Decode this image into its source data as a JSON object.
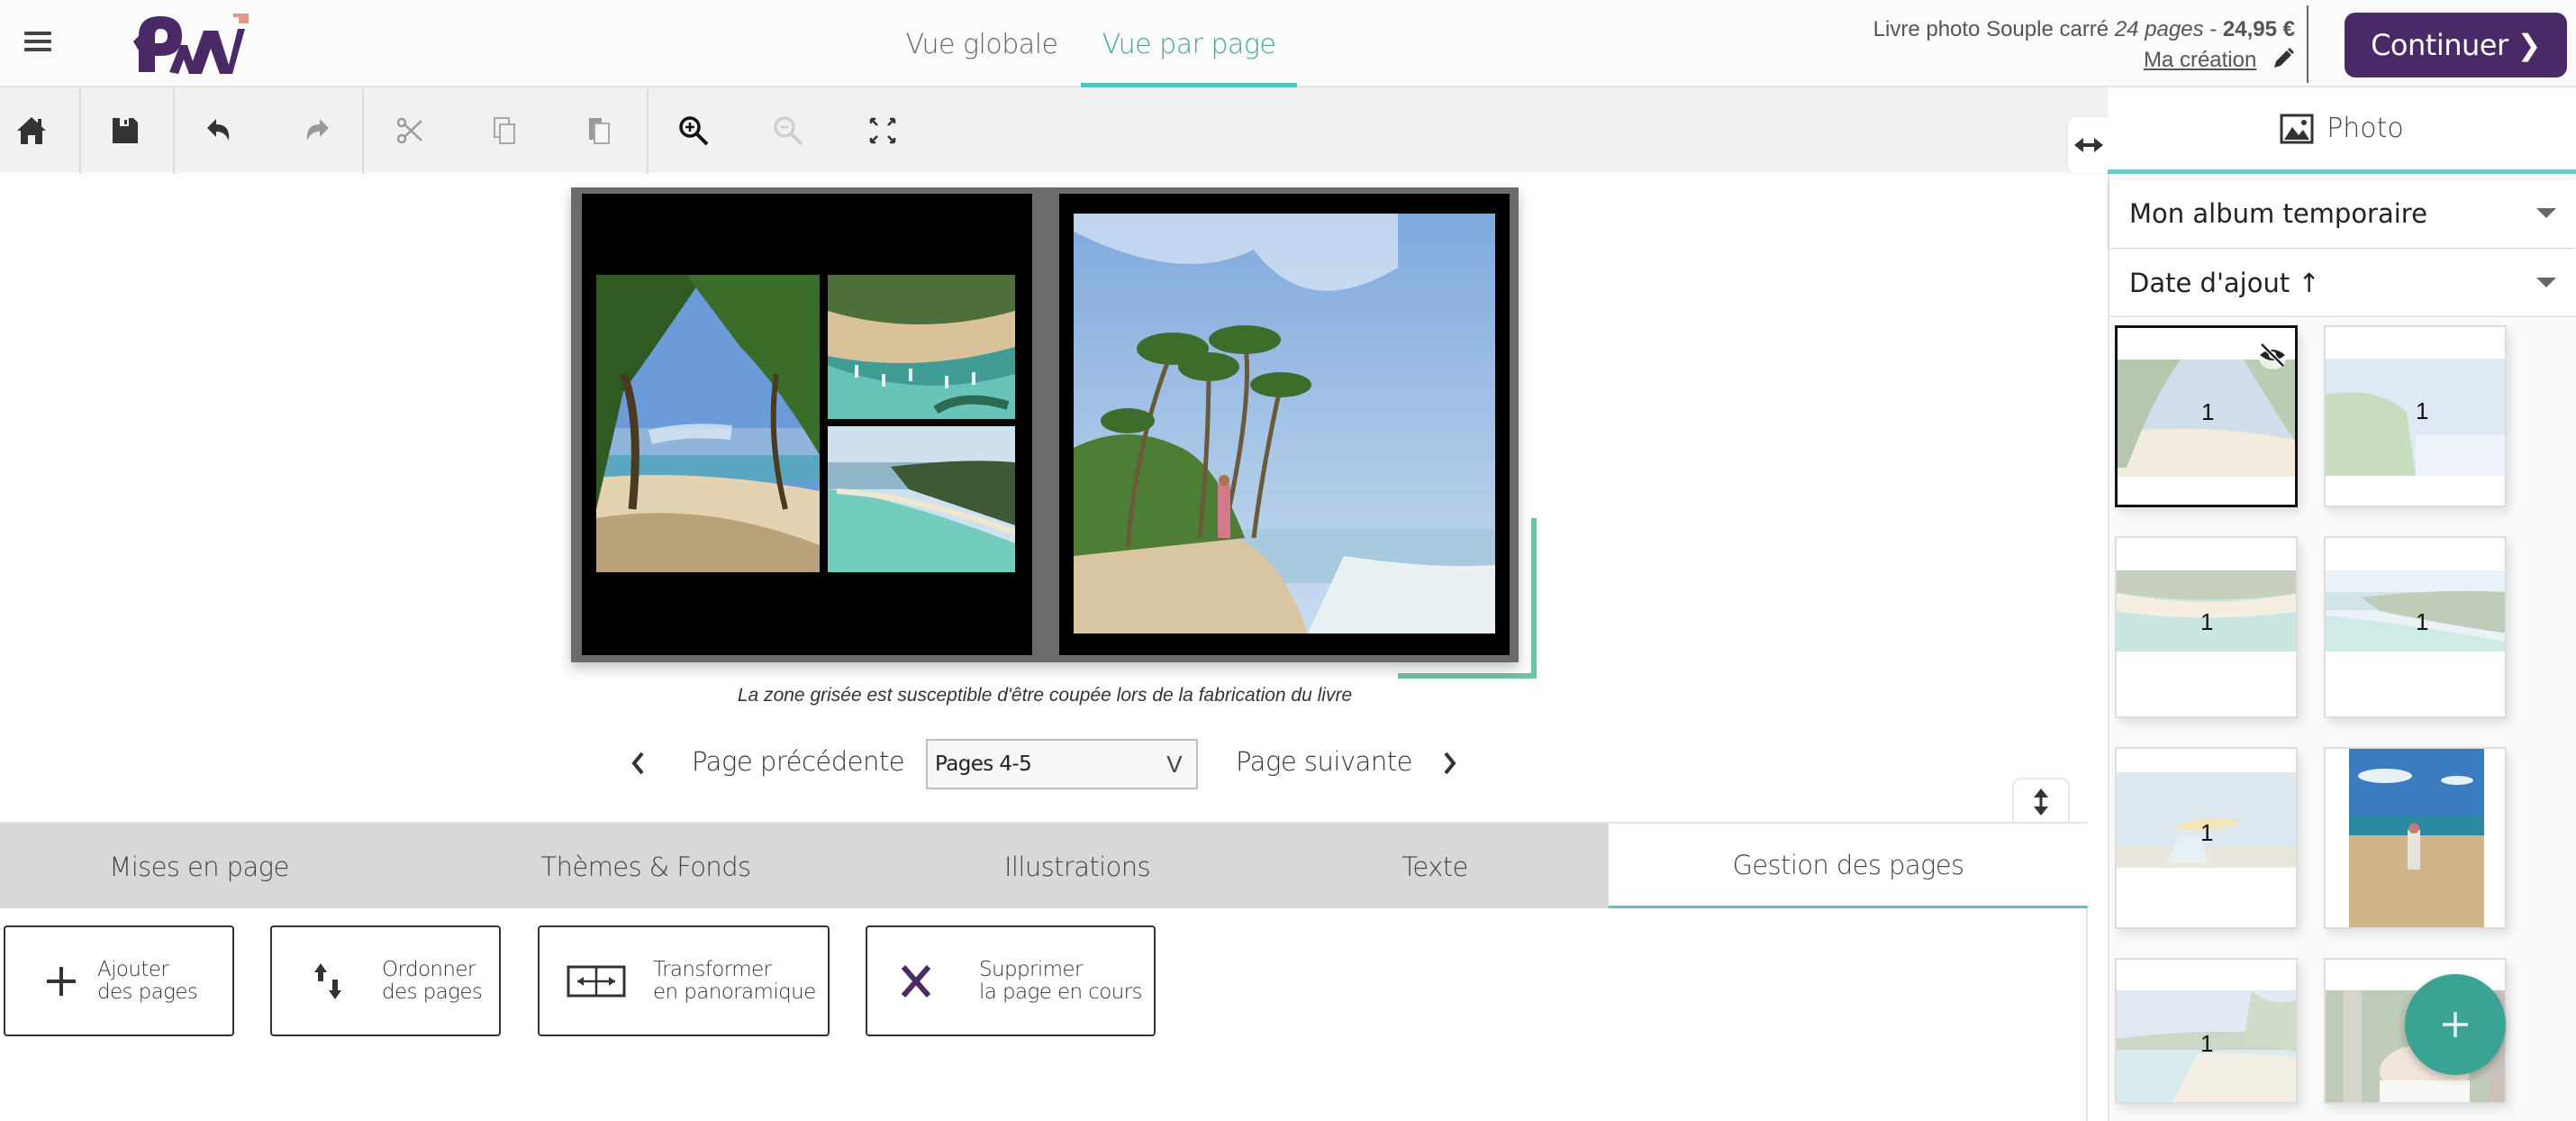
{
  "header": {
    "logo_text": "PW",
    "view_tabs": [
      {
        "label": "Vue globale",
        "active": false
      },
      {
        "label": "Vue par page",
        "active": true
      }
    ],
    "product": {
      "name": "Livre photo Souple carré",
      "pages": "24 pages",
      "separator": " - ",
      "price": "24,95 €"
    },
    "creation_link": "Ma création",
    "continue_label": "Continuer",
    "continue_chevron": "❯"
  },
  "toolbar": {
    "items": [
      {
        "name": "home",
        "enabled": true
      },
      {
        "name": "save",
        "enabled": true
      },
      {
        "name": "undo",
        "enabled": true
      },
      {
        "name": "redo",
        "enabled": false
      },
      {
        "name": "cut",
        "enabled": false
      },
      {
        "name": "copy",
        "enabled": false
      },
      {
        "name": "paste",
        "enabled": false
      },
      {
        "name": "zoom-in",
        "enabled": true
      },
      {
        "name": "zoom-out",
        "enabled": false
      },
      {
        "name": "fit-screen",
        "enabled": true
      }
    ]
  },
  "canvas": {
    "caption": "La zone grisée est susceptible d'être coupée lors de la fabrication du livre",
    "colors": {
      "page_bg": "#000000",
      "bleed": "#6b6b6b",
      "crop_guide": "#6cc3a8"
    }
  },
  "page_nav": {
    "prev_label": "Page précédente",
    "next_label": "Page suivante",
    "selected_pages": "Pages 4-5",
    "select_caret": "V"
  },
  "bottom_tabs": [
    {
      "label": "Mises en page",
      "active": false
    },
    {
      "label": "Thèmes & Fonds",
      "active": false
    },
    {
      "label": "Illustrations",
      "active": false
    },
    {
      "label": "Texte",
      "active": false
    },
    {
      "label": "Gestion des pages",
      "active": true
    }
  ],
  "page_actions": [
    {
      "line1": "Ajouter",
      "line2": "des pages",
      "icon": "plus-icon"
    },
    {
      "line1": "Ordonner",
      "line2": "des pages",
      "icon": "reorder-arrows-icon"
    },
    {
      "line1": "Transformer",
      "line2": "en panoramique",
      "icon": "panorama-icon"
    },
    {
      "line1": "Supprimer",
      "line2": "la page en cours",
      "icon": "delete-x-icon"
    }
  ],
  "side_panel": {
    "tab_label": "Photo",
    "album_select": "Mon album temporaire",
    "sort_select": "Date d'ajout ↑",
    "thumbnails": [
      {
        "usage_count": "1",
        "selected": true,
        "hidden_badge": true
      },
      {
        "usage_count": "1",
        "selected": false,
        "hidden_badge": false
      },
      {
        "usage_count": "1",
        "selected": false,
        "hidden_badge": false
      },
      {
        "usage_count": "1",
        "selected": false,
        "hidden_badge": false
      },
      {
        "usage_count": "1",
        "selected": false,
        "hidden_badge": false
      },
      {
        "usage_count": "",
        "selected": false,
        "hidden_badge": false
      },
      {
        "usage_count": "1",
        "selected": false,
        "hidden_badge": false
      },
      {
        "usage_count": "",
        "selected": false,
        "hidden_badge": false
      }
    ],
    "fab_label": "+"
  },
  "colors": {
    "brand_purple": "#4a2a66",
    "accent_teal": "#4ec6c3",
    "fab_green": "#3aa394",
    "logo_accent": "#e8968a"
  }
}
